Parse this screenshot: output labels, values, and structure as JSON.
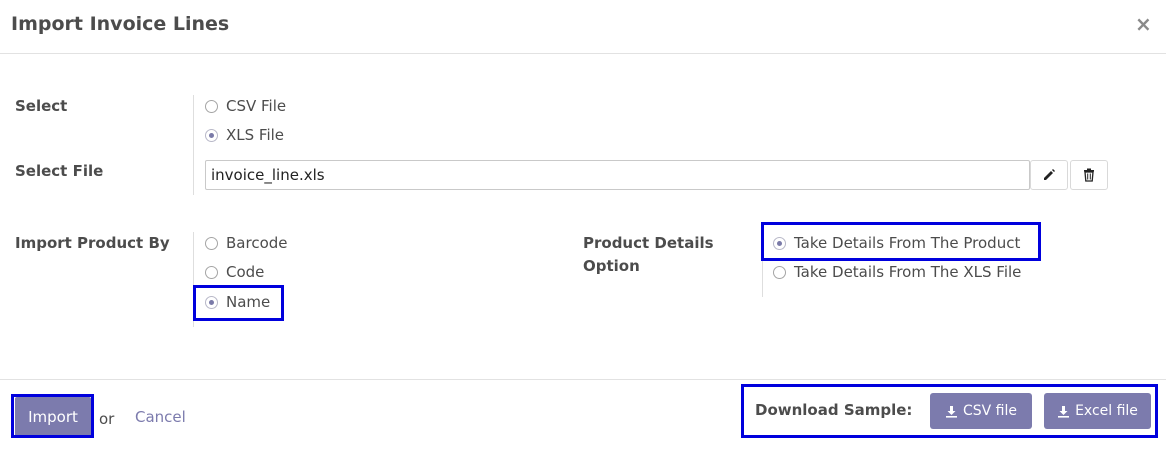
{
  "dialog": {
    "title": "Import Invoice Lines",
    "close_icon": "×"
  },
  "select": {
    "label": "Select",
    "options": [
      "CSV File",
      "XLS File"
    ],
    "selected": "XLS File"
  },
  "select_file": {
    "label": "Select File",
    "value": "invoice_line.xls"
  },
  "import_product_by": {
    "label": "Import Product By",
    "options": [
      "Barcode",
      "Code",
      "Name"
    ],
    "selected": "Name"
  },
  "product_details": {
    "label_line1": "Product Details",
    "label_line2": "Option",
    "options": [
      "Take Details From The Product",
      "Take Details From The XLS File"
    ],
    "selected": "Take Details From The Product"
  },
  "footer": {
    "import_label": "Import",
    "or_text": "or",
    "cancel_label": "Cancel",
    "download_label": "Download Sample:",
    "csv_button": "CSV file",
    "excel_button": "Excel file"
  },
  "colors": {
    "accent": "#7c7bad",
    "highlight": "#0000dd"
  }
}
